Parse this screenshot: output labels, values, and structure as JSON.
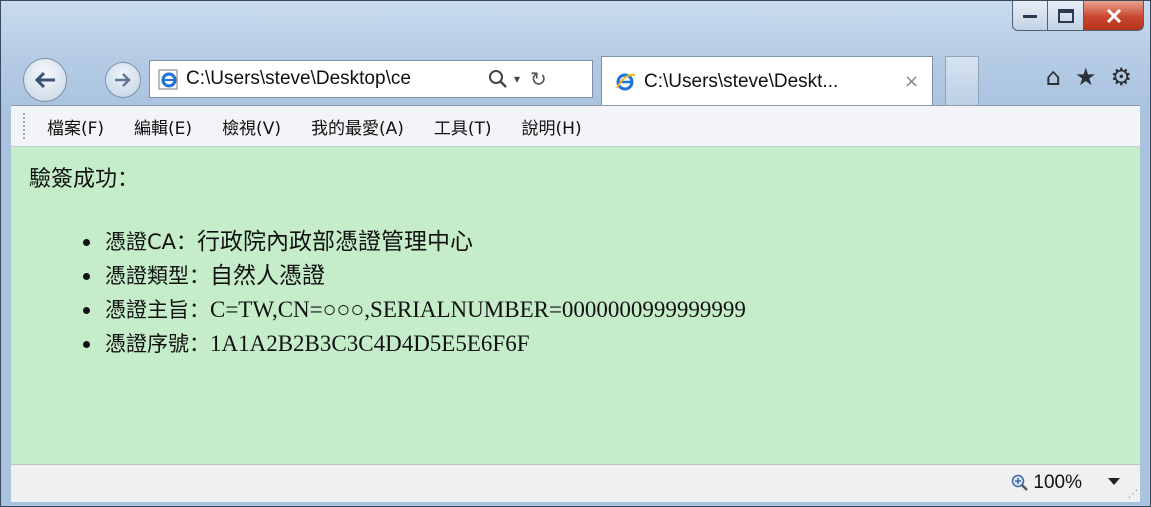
{
  "browser": {
    "address_url": "C:\\Users\\steve\\Desktop\\ce",
    "tab_title": "C:\\Users\\steve\\Deskt...",
    "tab_close": "×",
    "search_glyph": "⚲",
    "drop_glyph": "▾",
    "refresh_glyph": "↻",
    "home_glyph": "⌂",
    "favorites_glyph": "★",
    "tools_glyph": "⚙"
  },
  "menu": {
    "items": [
      "檔案(F)",
      "編輯(E)",
      "檢視(V)",
      "我的最愛(A)",
      "工具(T)",
      "說明(H)"
    ]
  },
  "content": {
    "title": "驗簽成功：",
    "details": [
      {
        "label": "憑證CA：",
        "value": "行政院內政部憑證管理中心"
      },
      {
        "label": "憑證類型：",
        "value": "自然人憑證"
      },
      {
        "label": "憑證主旨：",
        "value": "C=TW,CN=○○○,SERIALNUMBER=0000000999999999"
      },
      {
        "label": "憑證序號：",
        "value": "1A1A2B2B3C3C4D4D5E5E6F6F"
      }
    ]
  },
  "status": {
    "zoom": "100%"
  },
  "colors": {
    "content_bg": "#c5edc9",
    "close_button": "#c8472f"
  }
}
